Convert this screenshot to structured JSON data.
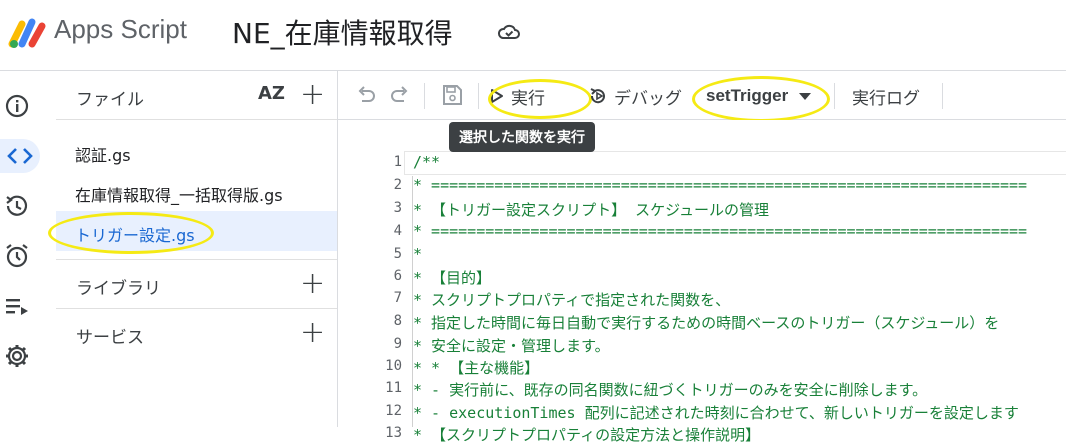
{
  "header": {
    "brand": "Apps Script",
    "project_title": "NE_在庫情報取得"
  },
  "files_panel": {
    "title": "ファイル",
    "sort_label": "AZ",
    "files": [
      {
        "name": "認証.gs"
      },
      {
        "name": "在庫情報取得_一括取得版.gs"
      },
      {
        "name": "トリガー設定.gs"
      }
    ],
    "sections": [
      {
        "label": "ライブラリ"
      },
      {
        "label": "サービス"
      }
    ]
  },
  "toolbar": {
    "run_label": "実行",
    "debug_label": "デバッグ",
    "function_name": "setTrigger",
    "log_label": "実行ログ",
    "tooltip": "選択した関数を実行"
  },
  "editor": {
    "lines": [
      {
        "num": "1",
        "text": "/**"
      },
      {
        "num": "2",
        "text": " * =================================================================="
      },
      {
        "num": "3",
        "text": " * 【トリガー設定スクリプト】 スケジュールの管理"
      },
      {
        "num": "4",
        "text": " * =================================================================="
      },
      {
        "num": "5",
        "text": " *"
      },
      {
        "num": "6",
        "text": " * 【目的】"
      },
      {
        "num": "7",
        "text": " * スクリプトプロパティで指定された関数を、"
      },
      {
        "num": "8",
        "text": " * 指定した時間に毎日自動で実行するための時間ベースのトリガー（スケジュール）を"
      },
      {
        "num": "9",
        "text": " * 安全に設定・管理します。"
      },
      {
        "num": "10",
        "text": " * * 【主な機能】"
      },
      {
        "num": "11",
        "text": " * - 実行前に、既存の同名関数に紐づくトリガーのみを安全に削除します。"
      },
      {
        "num": "12",
        "text": " * - executionTimes 配列に記述された時刻に合わせて、新しいトリガーを設定します"
      },
      {
        "num": "13",
        "text": " * 【スクリプトプロパティの設定方法と操作説明】"
      }
    ]
  },
  "colors": {
    "accent": "#1967d2",
    "selected_bg": "#e8f0fe",
    "highlight": "#f5ea14",
    "code_comment": "#188038"
  }
}
